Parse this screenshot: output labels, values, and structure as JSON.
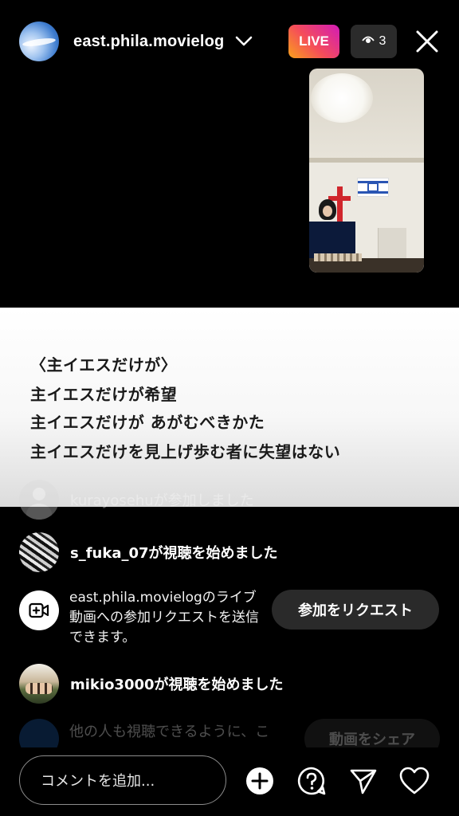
{
  "header": {
    "host_username": "east.phila.movielog",
    "live_label": "LIVE",
    "viewer_count": "3"
  },
  "lyrics": {
    "lines": [
      "〈主イエスだけが〉",
      "主イエスだけが希望",
      "主イエスだけが あがむべきかた",
      "主イエスだけを見上げ歩む者に失望はない"
    ]
  },
  "comments": [
    {
      "text": "kurayosehuが参加しました"
    },
    {
      "text": "s_fuka_07が視聴を始めました"
    },
    {
      "text": "mikio3000が視聴を始めました"
    }
  ],
  "request": {
    "text": "east.phila.movielogのライブ動画への参加リクエストを送信できます。",
    "button_label": "参加をリクエスト"
  },
  "faded_row": {
    "text": "他の人も視聴できるように、こ",
    "button_label": "動画をシェア"
  },
  "bottom_bar": {
    "comment_placeholder": "コメントを追加..."
  },
  "colors": {
    "live_gradient_start": "#f9a11b",
    "live_gradient_end": "#d21bb7",
    "background": "#000000"
  }
}
